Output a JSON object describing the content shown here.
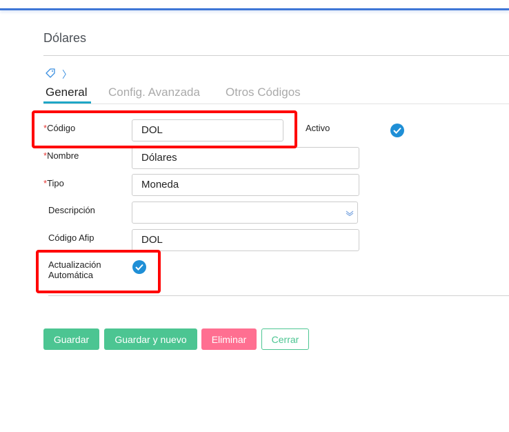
{
  "header": {
    "title": "Dólares"
  },
  "tabs": [
    {
      "label": "General",
      "active": true
    },
    {
      "label": "Config. Avanzada"
    },
    {
      "label": "Otros Códigos"
    }
  ],
  "form": {
    "codigo": {
      "label": "Código",
      "required": "*",
      "value": "DOL"
    },
    "activo": {
      "label": "Activo",
      "checked": true
    },
    "nombre": {
      "label": "Nombre",
      "required": "*",
      "value": "Dólares"
    },
    "tipo": {
      "label": "Tipo",
      "required": "*",
      "value": "Moneda"
    },
    "descripcion": {
      "label": "Descripción",
      "value": ""
    },
    "codigo_afip": {
      "label": "Código Afip",
      "value": "DOL"
    },
    "actualizacion": {
      "label_line1": "Actualización",
      "label_line2": "Automática",
      "checked": true
    }
  },
  "buttons": {
    "guardar": "Guardar",
    "guardar_nuevo": "Guardar y nuevo",
    "eliminar": "Eliminar",
    "cerrar": "Cerrar"
  },
  "colors": {
    "accent": "#1ea6c6",
    "primary": "#4cc592",
    "danger": "#ff6f91",
    "check": "#1f8fd6",
    "highlight": "#ff0000"
  }
}
